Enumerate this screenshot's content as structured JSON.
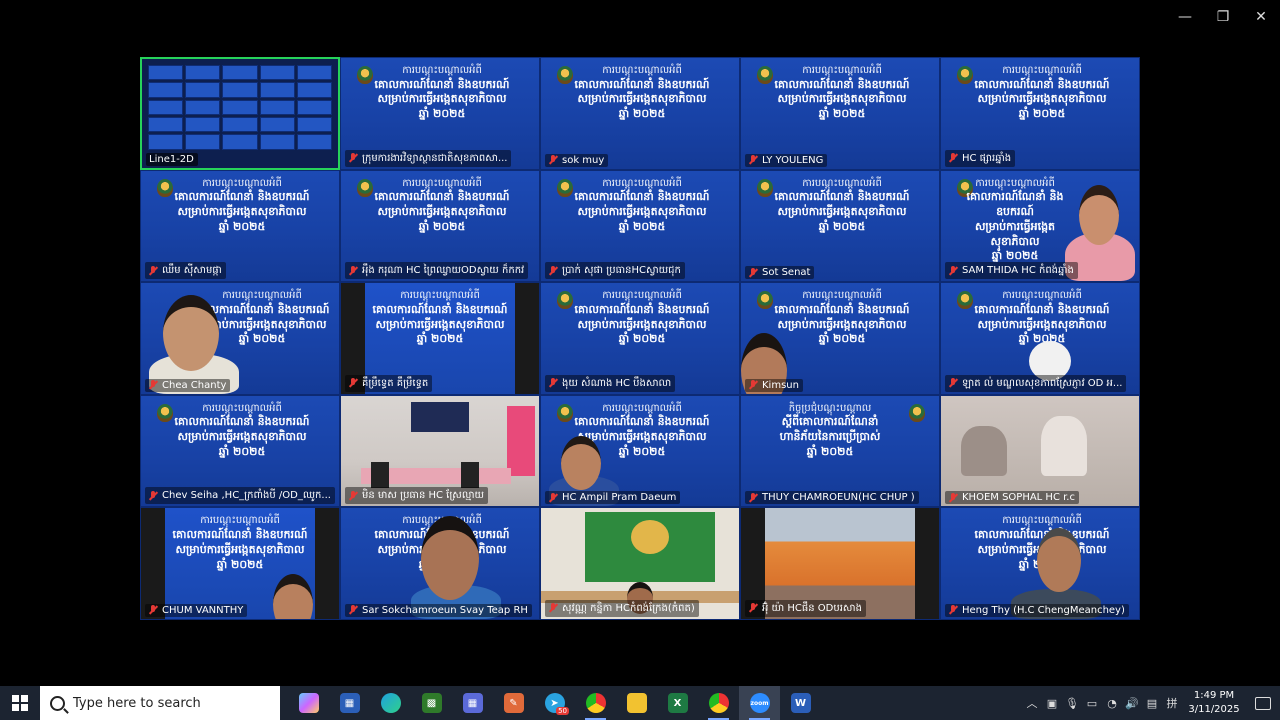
{
  "window": {
    "minimize": "—",
    "restore": "❐",
    "close": "✕"
  },
  "slide": {
    "line1": "ការបណ្តុះបណ្តាលអំពី",
    "line2": "គោលការណ៍ណែនាំ និងឧបករណ៍",
    "line3": "សម្រាប់ការធ្វើអង្កេតសុខាភិបាល",
    "line4": "ឆ្នាំ ២០២៥"
  },
  "alt_slide": {
    "line1": "កិច្ចប្រជុំបណ្តុះបណ្តាល",
    "line2": "ស្តីពីគោលការណ៍ណែនាំ",
    "line3": "ហានិភ័យនៃការប្រើប្រាស់",
    "line4": "ឆ្នាំ ២០២៥"
  },
  "participants": [
    "Line1-2D",
    "ក្រុមការងារវិទ្យាស្ថានជាតិសុខភាពសា...",
    "sok muy",
    "LY YOULENG",
    "HC ផ្សារឆ្នាំង",
    "ឈឹម សុីសាមផ្កា",
    "អុឹង ករុណា HC ព្រៃឈ្វាយODស្វាយ ក៏កកវ",
    "ប្រាក់ សុផា ប្រធានHCស្វាយជុក",
    "Sot Senat",
    "SAM THIDA HC កំពង់ឆ្នាំង",
    "Chea Chanty",
    "គឹម្រឹទ្ធេត គឹម្រឹទ្ធេត",
    "ងុយ សំណាង HC បឹងសាលា",
    "Kimsun",
    "ឡាត ល់ មណ្ឌលសុខភាពស្រែភ្ញាវ OD អ...",
    "Chev Seiha ,HC_ក្រពាំងបី /OD_ឈូក...",
    "មិន មាស ប្រធាន HC ស្រែល្មាយ",
    "HC Ampil Pram Daeum",
    "THUY CHAMROEUN(HC CHUP )",
    "KHOEM SOPHAL HC r.c",
    "CHUM VANNTHY",
    "Sar Sokchamroeun Svay Teap RH",
    "សុវណ្ណ កន្និកា HCកំពង់ក្រែង(កំពត)",
    "អ៊ុំ យ៉ា HCផឹន ODបរសាង",
    "Heng Thy (H.C ChengMeanchey)"
  ],
  "taskbar": {
    "search_placeholder": "Type here to search",
    "apps": [
      "copilot-icon",
      "store-icon",
      "edge-icon",
      "game-icon",
      "grid-app-icon",
      "paint-icon",
      "telegram-icon",
      "chrome-icon",
      "file-explorer-icon",
      "excel-icon",
      "chrome-icon",
      "zoom-icon",
      "word-icon"
    ],
    "telegram_badge": "50",
    "zoom_label": "zoom",
    "time": "1:49 PM",
    "date": "3/11/2025"
  },
  "colors": {
    "slide_blue": "#1842a6",
    "active_border": "#27d35a",
    "mic_muted": "#e53935",
    "taskbar": "#1c2431"
  }
}
